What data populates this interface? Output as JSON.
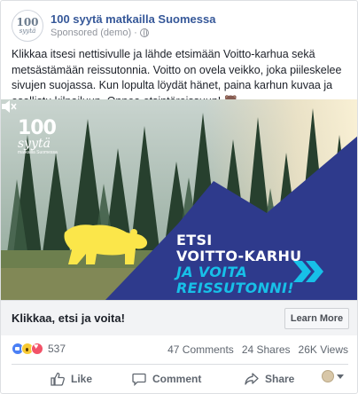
{
  "post": {
    "page_name": "100 syytä matkailla Suomessa",
    "sponsored": "Sponsored (demo) ·",
    "avatar": {
      "num": "100",
      "word": "syytä"
    },
    "message": "Klikkaa itsesi nettisivulle ja lähde etsimään Voitto-karhua sekä metsästämään reissutonnia. Voitto on ovela veikko, joka piileskelee sivujen suojassa. Kun lopulta löydät hänet, paina karhun kuvaa ja osallistu kilpailuun. Onnea etsintäreissuun! 🐻"
  },
  "media": {
    "logo_num": "100",
    "logo_word": "syytä",
    "logo_sub": "matkailla Suomessa",
    "line1": "ETSI",
    "line2": "VOITTO-KARHU",
    "line3": "JA VOITA",
    "line4": "REISSUTONNI!",
    "colors": {
      "mountain": "#2e3a8c",
      "bear": "#fbe64a",
      "accent": "#17c0e8"
    }
  },
  "cta": {
    "text": "Klikkaa, etsi ja voita!",
    "button": "Learn More"
  },
  "stats": {
    "reactions": "537",
    "comments": "47 Comments",
    "shares": "24 Shares",
    "views": "26K Views"
  },
  "actions": {
    "like": "Like",
    "comment": "Comment",
    "share": "Share"
  }
}
